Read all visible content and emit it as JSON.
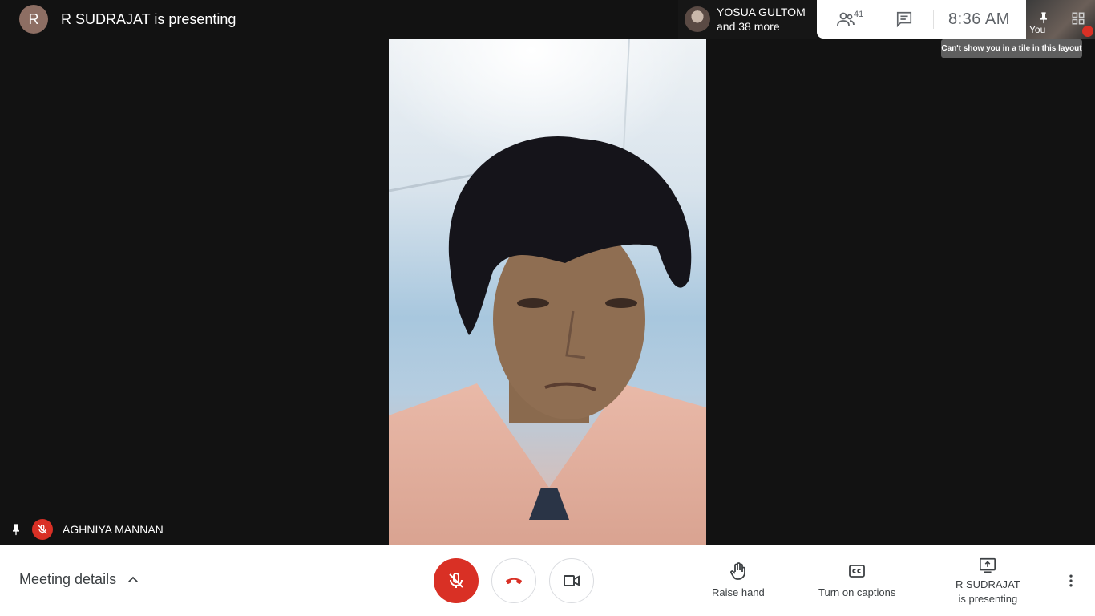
{
  "header": {
    "presenter_initial": "R",
    "presenting_title": "R SUDRAJAT is presenting"
  },
  "participants_chip": {
    "name": "YOSUA GULTOM",
    "more": "and 38 more"
  },
  "toolbar": {
    "participant_count": "41",
    "clock": "8:36  AM"
  },
  "self_tile": {
    "label": "You"
  },
  "tooltip": {
    "text": "Can't show you in a tile in this layout"
  },
  "speaker": {
    "name": "AGHNIYA MANNAN"
  },
  "bottom_bar": {
    "meeting_details": "Meeting details",
    "raise_hand": "Raise hand",
    "captions": "Turn on captions",
    "presenting_line1": "R SUDRAJAT",
    "presenting_line2": "is presenting"
  },
  "colors": {
    "accent_red": "#d93025",
    "bar_bg": "#ffffff",
    "stage_bg": "#121212"
  }
}
